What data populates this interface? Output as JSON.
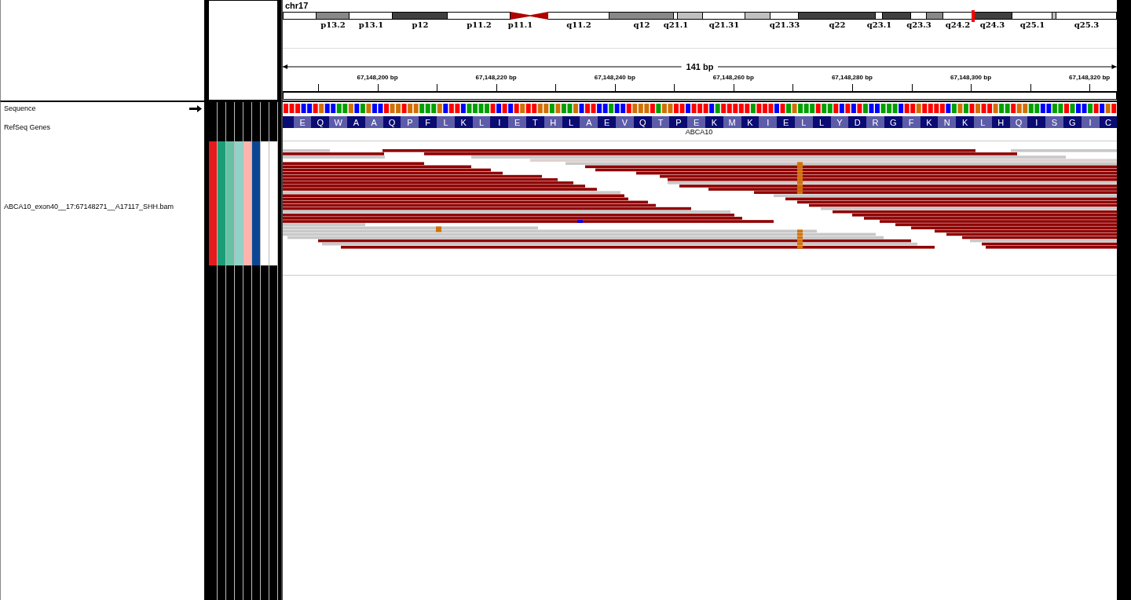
{
  "header": {
    "chromosome": "chr17",
    "bands": [
      {
        "kind": "gneg"
      },
      {
        "kind": "gpos50",
        "label": "p13.2"
      },
      {
        "kind": "gneg",
        "label": "p13.1"
      },
      {
        "kind": "gpos75",
        "label": "p12"
      },
      {
        "kind": "gneg",
        "label": "p11.2"
      },
      {
        "kind": "acen_p",
        "label": "p11.1"
      },
      {
        "kind": "acen_q"
      },
      {
        "kind": "gneg",
        "label": "q11.2"
      },
      {
        "kind": "gpos50",
        "label": "q12"
      },
      {
        "kind": "gneg",
        "label": "q21.1"
      },
      {
        "kind": "gpos25"
      },
      {
        "kind": "gneg",
        "label": "q21.31"
      },
      {
        "kind": "gpos25"
      },
      {
        "kind": "gneg",
        "label": "q21.33"
      },
      {
        "kind": "gpos75",
        "label": "q22"
      },
      {
        "kind": "gneg",
        "label": "q23.1"
      },
      {
        "kind": "gpos75"
      },
      {
        "kind": "gneg",
        "label": "q23.3"
      },
      {
        "kind": "gpos50"
      },
      {
        "kind": "gneg",
        "label": "q24.2"
      },
      {
        "kind": "gpos75",
        "label": "q24.3"
      },
      {
        "kind": "gneg",
        "label": "q25.1"
      },
      {
        "kind": "gpos25"
      },
      {
        "kind": "gneg",
        "label": "q25.3"
      }
    ],
    "span": "141 bp",
    "ticks": [
      "67,148,200 bp",
      "67,148,220 bp",
      "67,148,240 bp",
      "67,148,260 bp",
      "67,148,280 bp",
      "67,148,300 bp",
      "67,148,320 bp"
    ]
  },
  "tracks": {
    "sequence": {
      "name": "Sequence"
    },
    "genes": {
      "name": "RefSeq Genes",
      "gene": "ABCA10",
      "amino_acids": [
        "E",
        "Q",
        "W",
        "A",
        "A",
        "Q",
        "P",
        "F",
        "L",
        "K",
        "L",
        "I",
        "E",
        "T",
        "H",
        "L",
        "A",
        "E",
        "V",
        "Q",
        "T",
        "P",
        "E",
        "K",
        "M",
        "K",
        "I",
        "E",
        "L",
        "L",
        "Y",
        "D",
        "R",
        "G",
        "F",
        "K",
        "N",
        "K",
        "L",
        "H",
        "Q",
        "I",
        "S",
        "G",
        "I",
        "C"
      ]
    },
    "alignment": {
      "name": "ABCA10_exon40__17:67148271__A17117_SHH.bam"
    }
  },
  "attributes": [
    {
      "color": "#e41a1c"
    },
    {
      "color": "#1b9e77"
    },
    {
      "color": "#66c2a5"
    },
    {
      "color": "#8dd3c7"
    },
    {
      "color": "#fbb4ae"
    },
    {
      "color": "#0b4695"
    },
    {
      "color": "#ffffff"
    },
    {
      "color": "#ffffff"
    }
  ]
}
